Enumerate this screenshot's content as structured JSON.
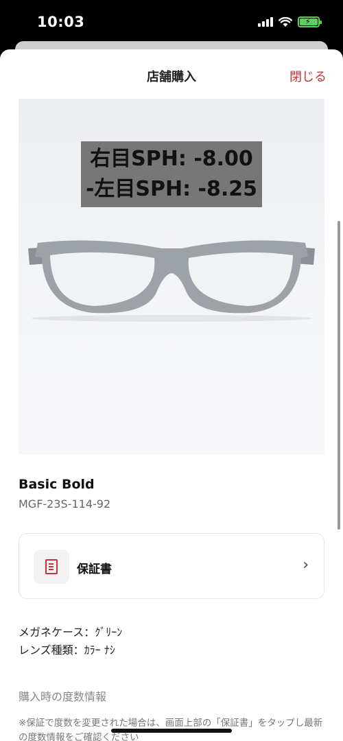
{
  "status_bar": {
    "time": "10:03",
    "battery_color": "#5ad05a"
  },
  "header": {
    "title": "店舗購入",
    "close_label": "閉じる",
    "accent_color": "#c2343a"
  },
  "product": {
    "image_overlay_line1": "右目SPH: -8.00",
    "image_overlay_line2": "-左目SPH: -8.25",
    "name": "Basic Bold",
    "code": "MGF-23S-114-92"
  },
  "warranty": {
    "label": "保証書",
    "icon": "document-icon"
  },
  "details": [
    "メガネケース：ｸﾞﾘｰﾝ",
    "レンズ種類：ｶﾗｰ ﾅｼ"
  ],
  "prescription": {
    "section_label": "購入時の度数情報",
    "note": "※保証で度数を変更された場合は、画面上部の「保証書」をタップし最新の度数情報をご確認ください"
  }
}
